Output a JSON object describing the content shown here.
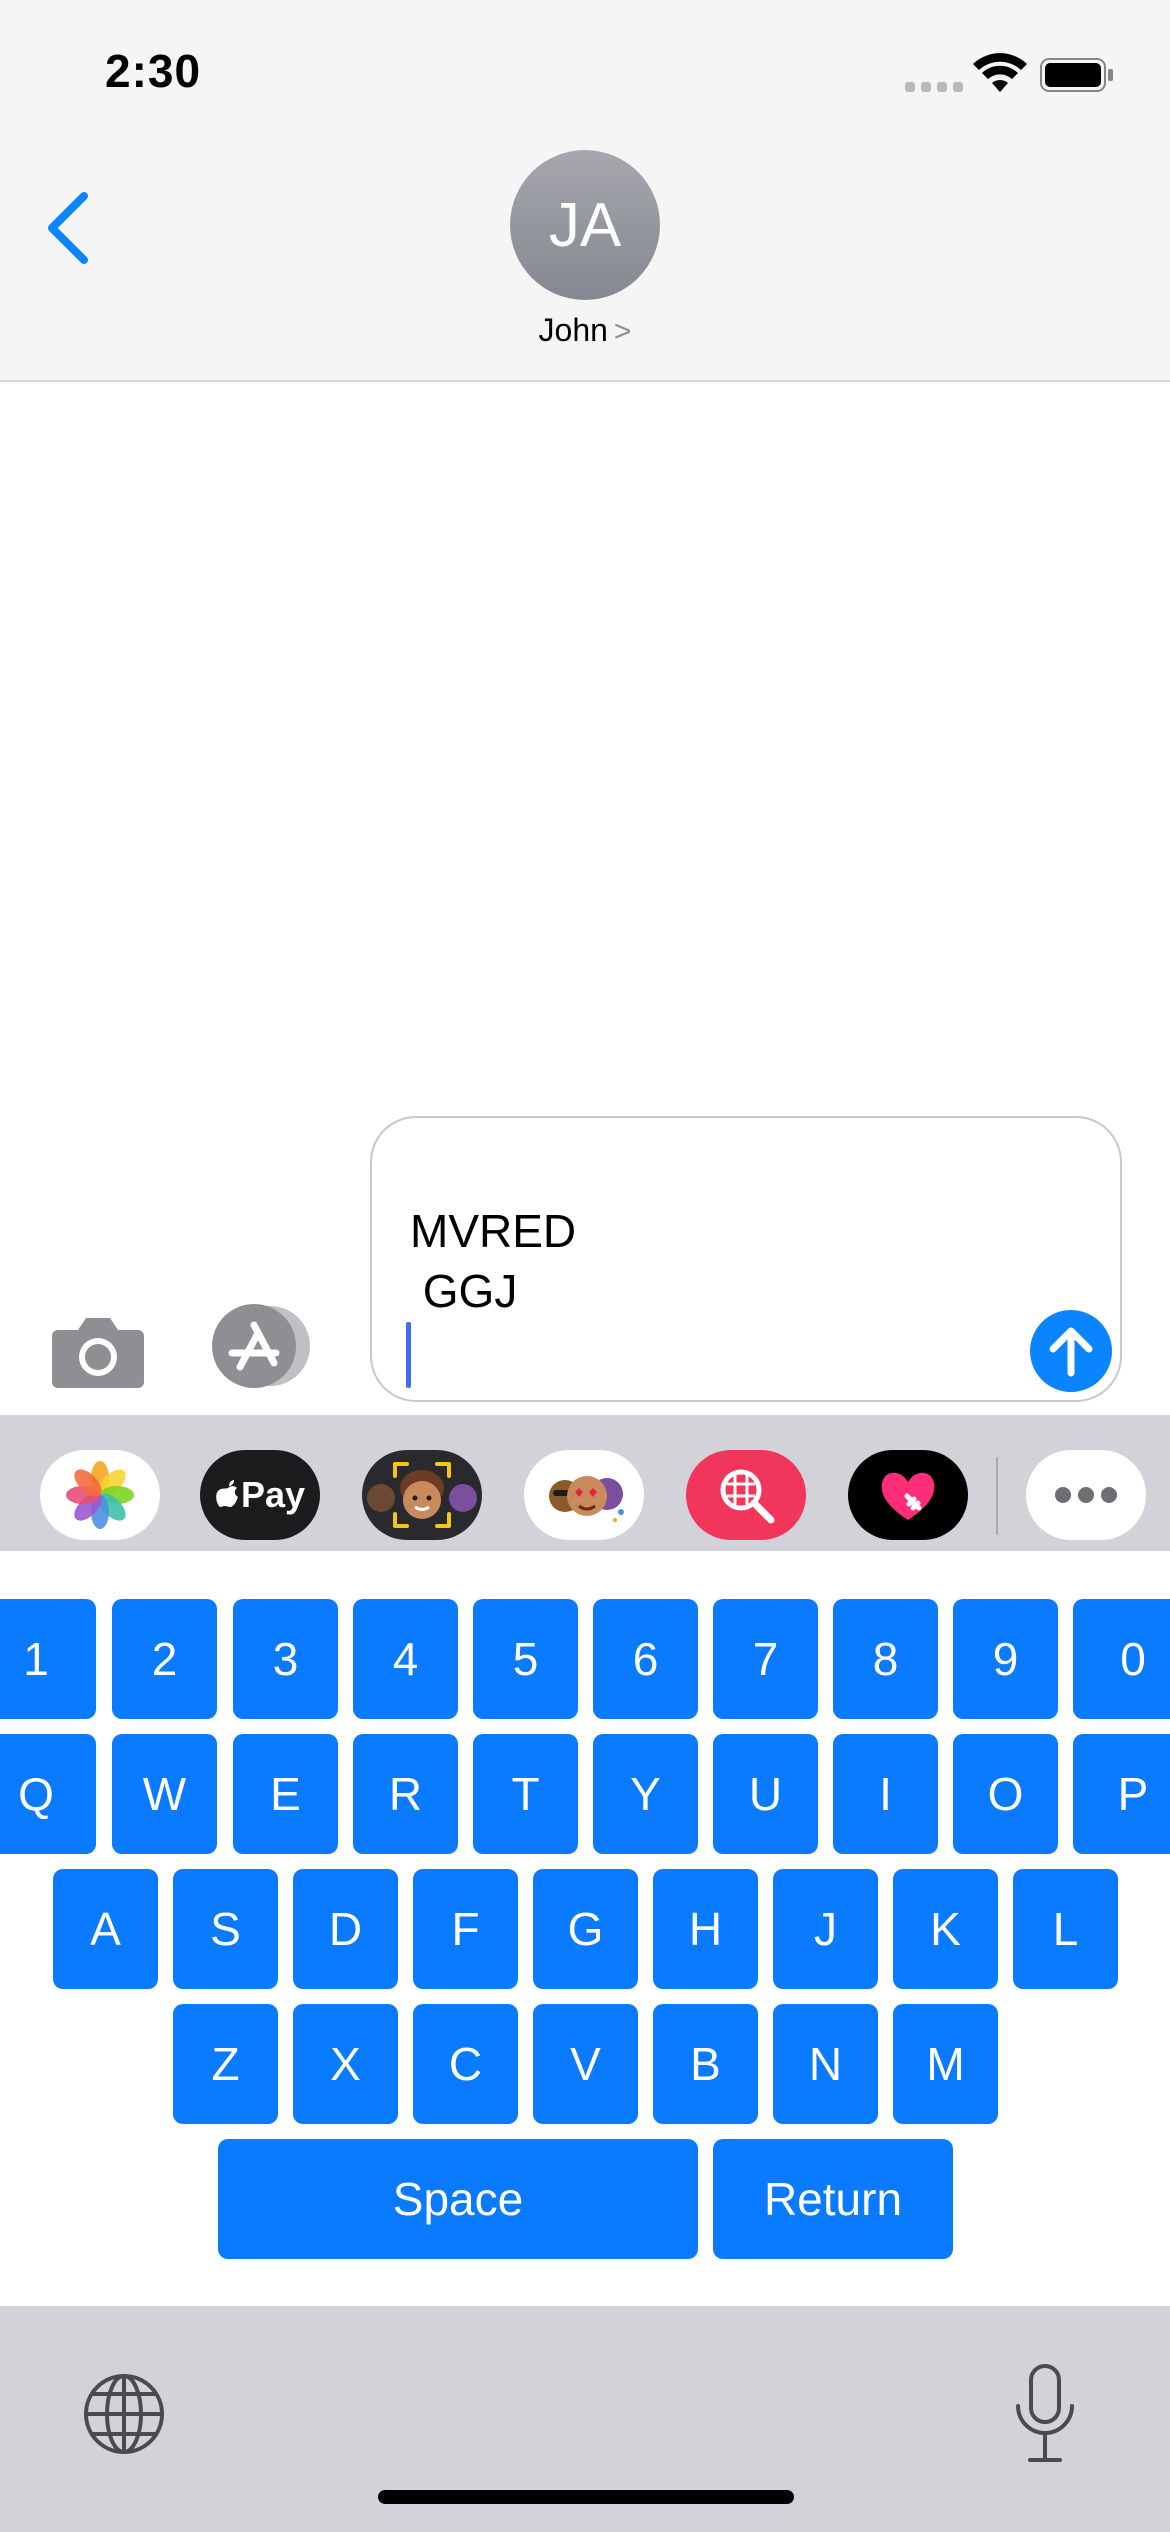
{
  "status_bar": {
    "time": "2:30"
  },
  "header": {
    "avatar_initials": "JA",
    "contact_name": "John",
    "contact_chevron": ">"
  },
  "compose": {
    "line1": "MVRED",
    "line2": " GGJ"
  },
  "app_strip": {
    "items": [
      {
        "name": "photos-app-icon"
      },
      {
        "name": "apple-pay-app-icon",
        "label": "Pay"
      },
      {
        "name": "memoji-app-icon"
      },
      {
        "name": "memoji-stickers-app-icon"
      },
      {
        "name": "image-search-app-icon"
      },
      {
        "name": "digital-touch-app-icon"
      },
      {
        "name": "more-apps-icon"
      }
    ]
  },
  "keyboard": {
    "row_numbers": [
      "1",
      "2",
      "3",
      "4",
      "5",
      "6",
      "7",
      "8",
      "9",
      "0"
    ],
    "row_top": [
      "Q",
      "W",
      "E",
      "R",
      "T",
      "Y",
      "U",
      "I",
      "O",
      "P"
    ],
    "row_middle": [
      "A",
      "S",
      "D",
      "F",
      "G",
      "H",
      "J",
      "K",
      "L"
    ],
    "row_bottom": [
      "Z",
      "X",
      "C",
      "V",
      "B",
      "N",
      "M"
    ],
    "space_label": "Space",
    "return_label": "Return"
  },
  "colors": {
    "accent": "#0a84ff",
    "key_blue": "#0a7aff",
    "bar_gray": "#f5f5f5",
    "tray_gray": "#d1d3d9"
  }
}
